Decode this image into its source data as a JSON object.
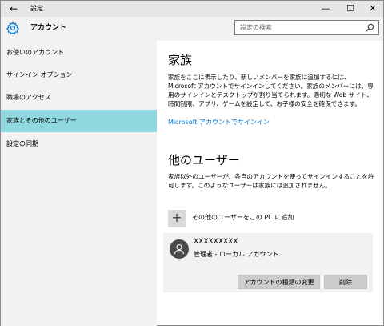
{
  "window": {
    "title": "設定",
    "back_glyph": "←",
    "min_glyph": "—",
    "max_glyph": "☐",
    "close_glyph": "✕"
  },
  "app": {
    "title": "アカウント"
  },
  "search": {
    "placeholder": "設定の検索"
  },
  "sidebar": {
    "items": [
      {
        "label": "お使いのアカウント",
        "selected": false
      },
      {
        "label": "サインイン オプション",
        "selected": false
      },
      {
        "label": "職場のアクセス",
        "selected": false
      },
      {
        "label": "家族とその他のユーザー",
        "selected": true
      },
      {
        "label": "設定の同期",
        "selected": false
      }
    ]
  },
  "family": {
    "heading": "家族",
    "description": "家族をここに表示したり、新しいメンバーを家族に追加するには、Microsoft アカウントでサインインしてください。家族のメンバーには、専用のサインインとデスクトップが割り当てられます。適切な Web サイト、時間制限、アプリ、ゲームを設定して、お子様の安全を確保できます。",
    "link": "Microsoft アカウントでサインイン"
  },
  "others": {
    "heading": "他のユーザー",
    "description": "家族以外のユーザーが、各自のアカウントを使ってサインインすることを許可します。このようなユーザーは家族には追加されません。",
    "add_label": "その他のユーザーをこの PC に追加",
    "add_glyph": "+"
  },
  "user": {
    "name": "XXXXXXXXX",
    "role": "管理者 - ローカル アカウント",
    "change_button": "アカウントの種類の変更",
    "delete_button": "削除"
  },
  "colors": {
    "accent": "#0078d7",
    "selected_nav": "#8fd8e0",
    "pane_bg": "#f2f2f2"
  }
}
